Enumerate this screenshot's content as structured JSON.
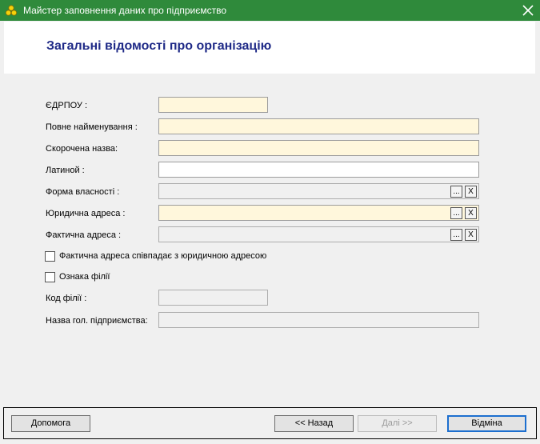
{
  "window": {
    "title": "Майстер заповнення даних про підприємство",
    "icon": "app-logo-icon",
    "close_icon": "close-icon"
  },
  "header": {
    "title": "Загальні відомості про організацію"
  },
  "form": {
    "edrpou": {
      "label": "ЄДРПОУ :",
      "value": ""
    },
    "full_name": {
      "label": "Повне найменування :",
      "value": ""
    },
    "short_name": {
      "label": "Скорочена назва:",
      "value": ""
    },
    "latin": {
      "label": "Латиной :",
      "value": ""
    },
    "ownership": {
      "label": "Форма власності :",
      "value": "",
      "browse": "...",
      "clear": "X"
    },
    "legal_address": {
      "label": "Юридична адреса :",
      "value": "",
      "browse": "...",
      "clear": "X"
    },
    "actual_address": {
      "label": "Фактична адреса :",
      "value": "",
      "browse": "...",
      "clear": "X"
    },
    "same_address": {
      "label": "Фактична адреса співпадає з юридичною адресою",
      "checked": false
    },
    "branch_flag": {
      "label": "Ознака філії",
      "checked": false
    },
    "branch_code": {
      "label": "Код філії :",
      "value": ""
    },
    "parent_name": {
      "label": "Назва гол. підприємства:",
      "value": ""
    }
  },
  "footer": {
    "help": "Допомога",
    "back": "<< Назад",
    "next": "Далі >>",
    "cancel": "Відміна"
  },
  "colors": {
    "titlebar": "#2f8a3b",
    "header_title": "#1f2a87",
    "required_field": "#fff7dc",
    "focus_border": "#1d6fcf"
  }
}
